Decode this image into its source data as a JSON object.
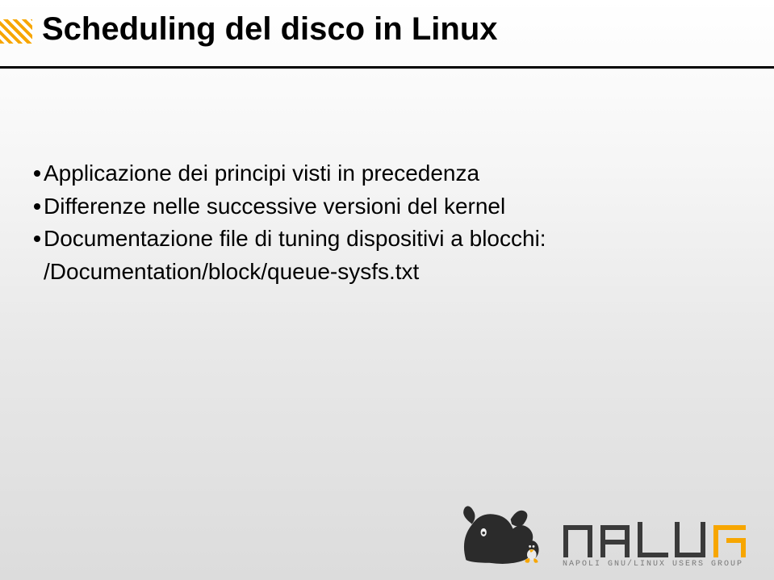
{
  "slide": {
    "title": "Scheduling del disco in Linux",
    "bullets": [
      "Applicazione dei principi visti in precedenza",
      "Differenze nelle successive versioni del kernel",
      "Documentazione file di tuning dispositivi a blocchi:"
    ],
    "sub_line": "/Documentation/block/queue-sysfs.txt"
  },
  "footer": {
    "org_subtitle": "NAPOLI GNU/LINUX USERS GROUP"
  }
}
